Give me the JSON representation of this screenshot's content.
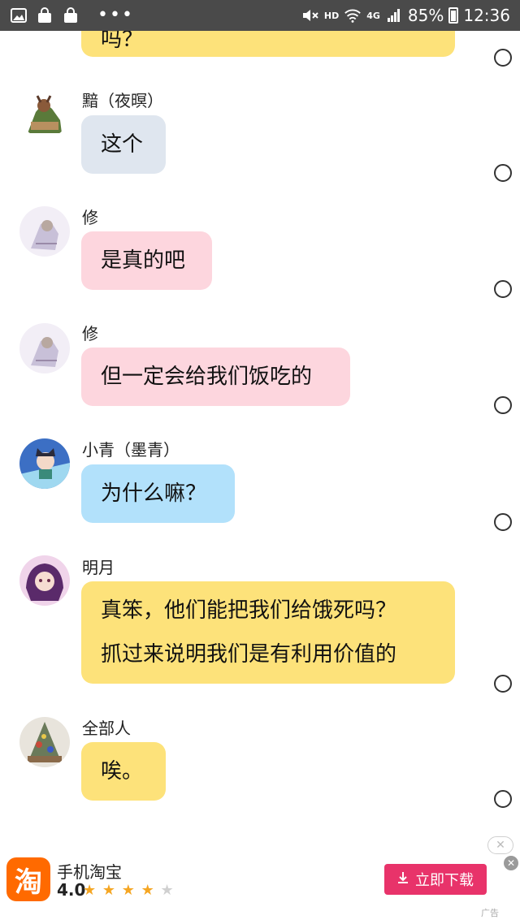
{
  "status_bar": {
    "hd": "HD",
    "network": "4G",
    "battery": "85%",
    "time": "12:36",
    "icons": [
      "gallery-icon",
      "shopping-bag-icon",
      "shopping-bag-icon",
      "more-dots-icon",
      "mute-icon",
      "wifi-icon",
      "signal-icon",
      "battery-icon"
    ]
  },
  "chat": {
    "top_bubble_partial": "吗？",
    "messages": [
      {
        "sender": "黯（夜暝）",
        "lines": [
          "这个"
        ],
        "color": "gray"
      },
      {
        "sender": "修",
        "lines": [
          "是真的吧"
        ],
        "color": "pink"
      },
      {
        "sender": "修",
        "lines": [
          "但一定会给我们饭吃的"
        ],
        "color": "pink"
      },
      {
        "sender": "小青（墨青）",
        "lines": [
          "为什么嘛？"
        ],
        "color": "blue"
      },
      {
        "sender": "明月",
        "lines": [
          "真笨，他们能把我们给饿死吗？",
          "抓过来说明我们是有利用价值的"
        ],
        "color": "yellow"
      },
      {
        "sender": "全部人",
        "lines": [
          "唉。"
        ],
        "color": "yellow"
      }
    ]
  },
  "ad": {
    "app_name": "手机淘宝",
    "logo_char": "淘",
    "rating": "4.0",
    "stars_filled": 4,
    "stars_total": 5,
    "download_label": "立即下载",
    "ad_tag": "广告"
  },
  "colors": {
    "status_bar": "#4a4a4a",
    "bubble_yellow": "#fde27a",
    "bubble_gray": "#dfe6ef",
    "bubble_pink": "#fdd6de",
    "bubble_blue": "#b2e1fb",
    "download_button": "#e8336a",
    "taobao_orange": "#ff6a00"
  }
}
